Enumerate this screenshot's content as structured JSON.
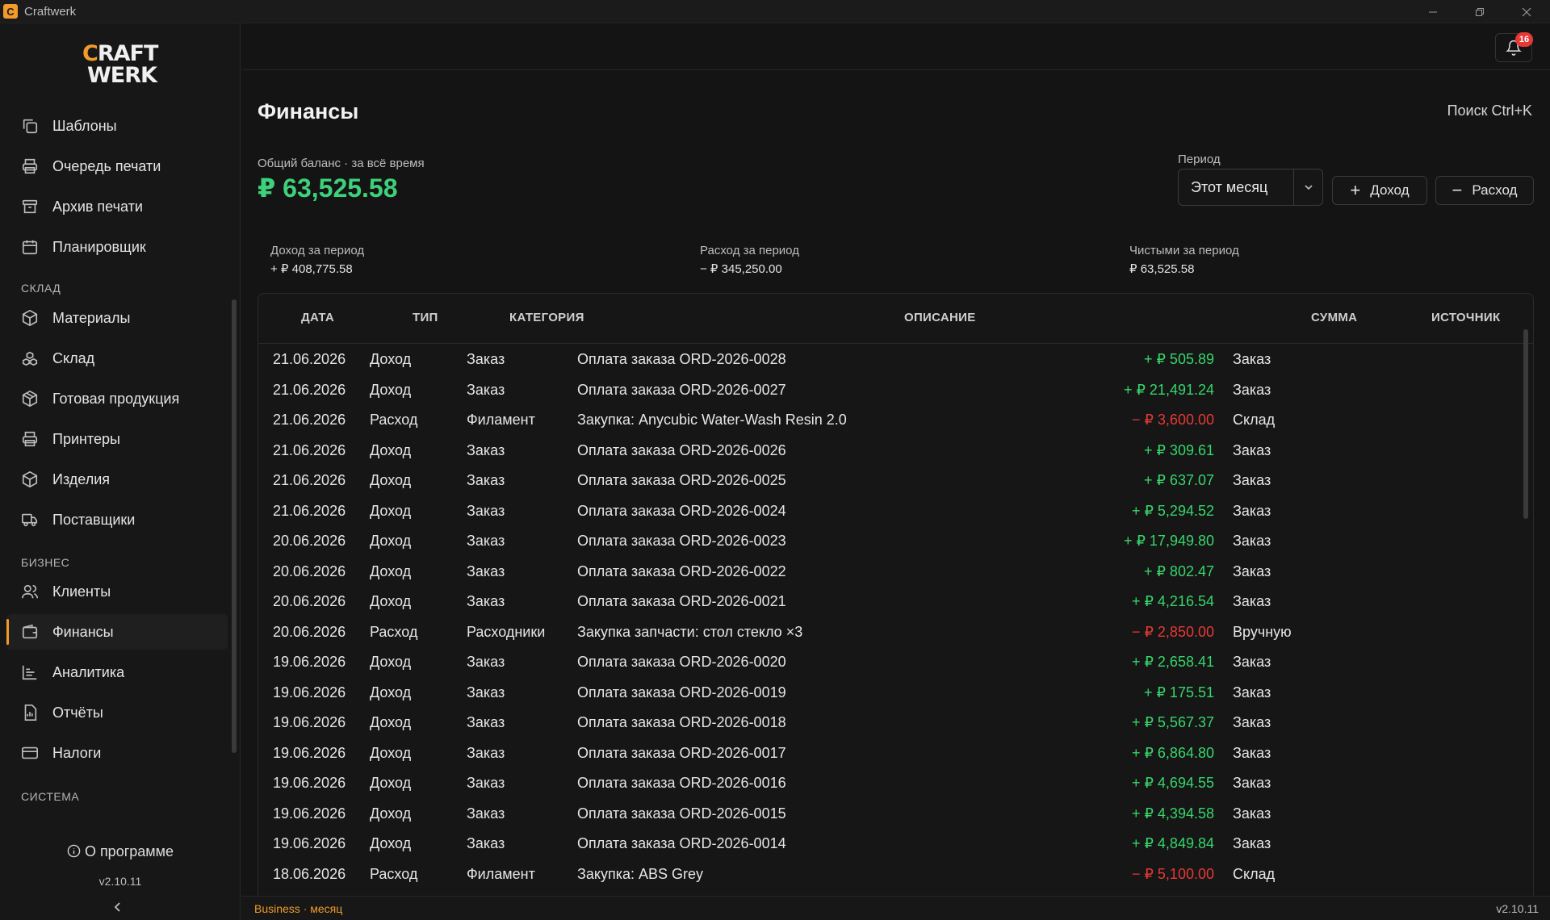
{
  "window": {
    "title": "Craftwerk",
    "icon": "C"
  },
  "logo": {
    "line1_accent": "C",
    "line1_rest": "RAFT",
    "line2": "WERK"
  },
  "sidebar": {
    "items_main": [
      {
        "label": "Шаблоны",
        "icon": "templates-icon"
      },
      {
        "label": "Очередь печати",
        "icon": "printer-icon"
      },
      {
        "label": "Архив печати",
        "icon": "archive-icon"
      },
      {
        "label": "Планировщик",
        "icon": "calendar-icon"
      }
    ],
    "section_warehouse": "СКЛАД",
    "items_warehouse": [
      {
        "label": "Материалы",
        "icon": "box-icon"
      },
      {
        "label": "Склад",
        "icon": "boxes-icon"
      },
      {
        "label": "Готовая продукция",
        "icon": "package-icon"
      },
      {
        "label": "Принтеры",
        "icon": "printer-icon"
      },
      {
        "label": "Изделия",
        "icon": "cube-icon"
      },
      {
        "label": "Поставщики",
        "icon": "truck-icon"
      }
    ],
    "section_business": "БИЗНЕС",
    "items_business": [
      {
        "label": "Клиенты",
        "icon": "users-icon"
      },
      {
        "label": "Финансы",
        "icon": "wallet-icon",
        "active": true
      },
      {
        "label": "Аналитика",
        "icon": "chart-icon"
      },
      {
        "label": "Отчёты",
        "icon": "report-icon"
      },
      {
        "label": "Налоги",
        "icon": "card-icon"
      }
    ],
    "section_system": "СИСТЕМА",
    "about": "О программе",
    "version": "v2.10.11",
    "collapse": "‹"
  },
  "topbar": {
    "notifications_count": "16"
  },
  "page": {
    "title": "Финансы",
    "search_hint": "Поиск  Ctrl+K",
    "balance_label": "Общий баланс · за всё время",
    "balance_value": "₽ 63,525.58",
    "period_label": "Период",
    "period_value": "Этот месяц",
    "income_button": "Доход",
    "expense_button": "Расход",
    "stats": {
      "income_label": "Доход за период",
      "income_value": "+ ₽ 408,775.58",
      "expense_label": "Расход за период",
      "expense_value": "− ₽ 345,250.00",
      "net_label": "Чистыми за период",
      "net_value": "₽ 63,525.58"
    }
  },
  "table": {
    "headers": {
      "date": "ДАТА",
      "type": "ТИП",
      "category": "КАТЕГОРИЯ",
      "description": "ОПИСАНИЕ",
      "amount": "СУММА",
      "source": "ИСТОЧНИК"
    },
    "rows": [
      {
        "date": "21.06.2026",
        "type": "Доход",
        "category": "Заказ",
        "description": "Оплата заказа ORD-2026-0028",
        "amount": "+ ₽ 505.89",
        "sign": "pos",
        "source": "Заказ"
      },
      {
        "date": "21.06.2026",
        "type": "Доход",
        "category": "Заказ",
        "description": "Оплата заказа ORD-2026-0027",
        "amount": "+ ₽ 21,491.24",
        "sign": "pos",
        "source": "Заказ"
      },
      {
        "date": "21.06.2026",
        "type": "Расход",
        "category": "Филамент",
        "description": "Закупка: Anycubic Water-Wash Resin 2.0",
        "amount": "− ₽ 3,600.00",
        "sign": "neg",
        "source": "Склад"
      },
      {
        "date": "21.06.2026",
        "type": "Доход",
        "category": "Заказ",
        "description": "Оплата заказа ORD-2026-0026",
        "amount": "+ ₽ 309.61",
        "sign": "pos",
        "source": "Заказ"
      },
      {
        "date": "21.06.2026",
        "type": "Доход",
        "category": "Заказ",
        "description": "Оплата заказа ORD-2026-0025",
        "amount": "+ ₽ 637.07",
        "sign": "pos",
        "source": "Заказ"
      },
      {
        "date": "21.06.2026",
        "type": "Доход",
        "category": "Заказ",
        "description": "Оплата заказа ORD-2026-0024",
        "amount": "+ ₽ 5,294.52",
        "sign": "pos",
        "source": "Заказ"
      },
      {
        "date": "20.06.2026",
        "type": "Доход",
        "category": "Заказ",
        "description": "Оплата заказа ORD-2026-0023",
        "amount": "+ ₽ 17,949.80",
        "sign": "pos",
        "source": "Заказ"
      },
      {
        "date": "20.06.2026",
        "type": "Доход",
        "category": "Заказ",
        "description": "Оплата заказа ORD-2026-0022",
        "amount": "+ ₽ 802.47",
        "sign": "pos",
        "source": "Заказ"
      },
      {
        "date": "20.06.2026",
        "type": "Доход",
        "category": "Заказ",
        "description": "Оплата заказа ORD-2026-0021",
        "amount": "+ ₽ 4,216.54",
        "sign": "pos",
        "source": "Заказ"
      },
      {
        "date": "20.06.2026",
        "type": "Расход",
        "category": "Расходники",
        "description": "Закупка запчасти: стол стекло ×3",
        "amount": "− ₽ 2,850.00",
        "sign": "neg",
        "source": "Вручную"
      },
      {
        "date": "19.06.2026",
        "type": "Доход",
        "category": "Заказ",
        "description": "Оплата заказа ORD-2026-0020",
        "amount": "+ ₽ 2,658.41",
        "sign": "pos",
        "source": "Заказ"
      },
      {
        "date": "19.06.2026",
        "type": "Доход",
        "category": "Заказ",
        "description": "Оплата заказа ORD-2026-0019",
        "amount": "+ ₽ 175.51",
        "sign": "pos",
        "source": "Заказ"
      },
      {
        "date": "19.06.2026",
        "type": "Доход",
        "category": "Заказ",
        "description": "Оплата заказа ORD-2026-0018",
        "amount": "+ ₽ 5,567.37",
        "sign": "pos",
        "source": "Заказ"
      },
      {
        "date": "19.06.2026",
        "type": "Доход",
        "category": "Заказ",
        "description": "Оплата заказа ORD-2026-0017",
        "amount": "+ ₽ 6,864.80",
        "sign": "pos",
        "source": "Заказ"
      },
      {
        "date": "19.06.2026",
        "type": "Доход",
        "category": "Заказ",
        "description": "Оплата заказа ORD-2026-0016",
        "amount": "+ ₽ 4,694.55",
        "sign": "pos",
        "source": "Заказ"
      },
      {
        "date": "19.06.2026",
        "type": "Доход",
        "category": "Заказ",
        "description": "Оплата заказа ORD-2026-0015",
        "amount": "+ ₽ 4,394.58",
        "sign": "pos",
        "source": "Заказ"
      },
      {
        "date": "19.06.2026",
        "type": "Доход",
        "category": "Заказ",
        "description": "Оплата заказа ORD-2026-0014",
        "amount": "+ ₽ 4,849.84",
        "sign": "pos",
        "source": "Заказ"
      },
      {
        "date": "18.06.2026",
        "type": "Расход",
        "category": "Филамент",
        "description": "Закупка: ABS Grey",
        "amount": "− ₽ 5,100.00",
        "sign": "neg",
        "source": "Склад"
      }
    ]
  },
  "footer": {
    "plan": "Business · месяц",
    "version": "v2.10.11"
  },
  "colors": {
    "accent": "#f29b2b",
    "positive": "#36d66b",
    "negative": "#e53935",
    "balance": "#3ed07a"
  }
}
